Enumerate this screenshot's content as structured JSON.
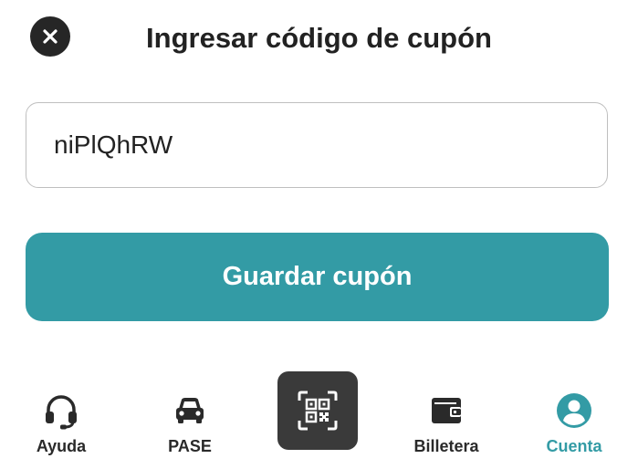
{
  "header": {
    "title": "Ingresar código de cupón",
    "close_icon": "close-icon"
  },
  "coupon_input": {
    "value": "niPlQhRW",
    "placeholder": ""
  },
  "save_button": {
    "label": "Guardar cupón"
  },
  "bottom_nav": {
    "items": [
      {
        "label": "Ayuda",
        "icon": "headset-icon",
        "active": false
      },
      {
        "label": "PASE",
        "icon": "car-icon",
        "active": false
      },
      {
        "label": "",
        "icon": "qr-scan-icon",
        "active": false
      },
      {
        "label": "Billetera",
        "icon": "wallet-icon",
        "active": false
      },
      {
        "label": "Cuenta",
        "icon": "account-icon",
        "active": true
      }
    ]
  },
  "colors": {
    "accent": "#339ba5",
    "dark": "#262626",
    "scan_button": "#3a3a3a"
  }
}
